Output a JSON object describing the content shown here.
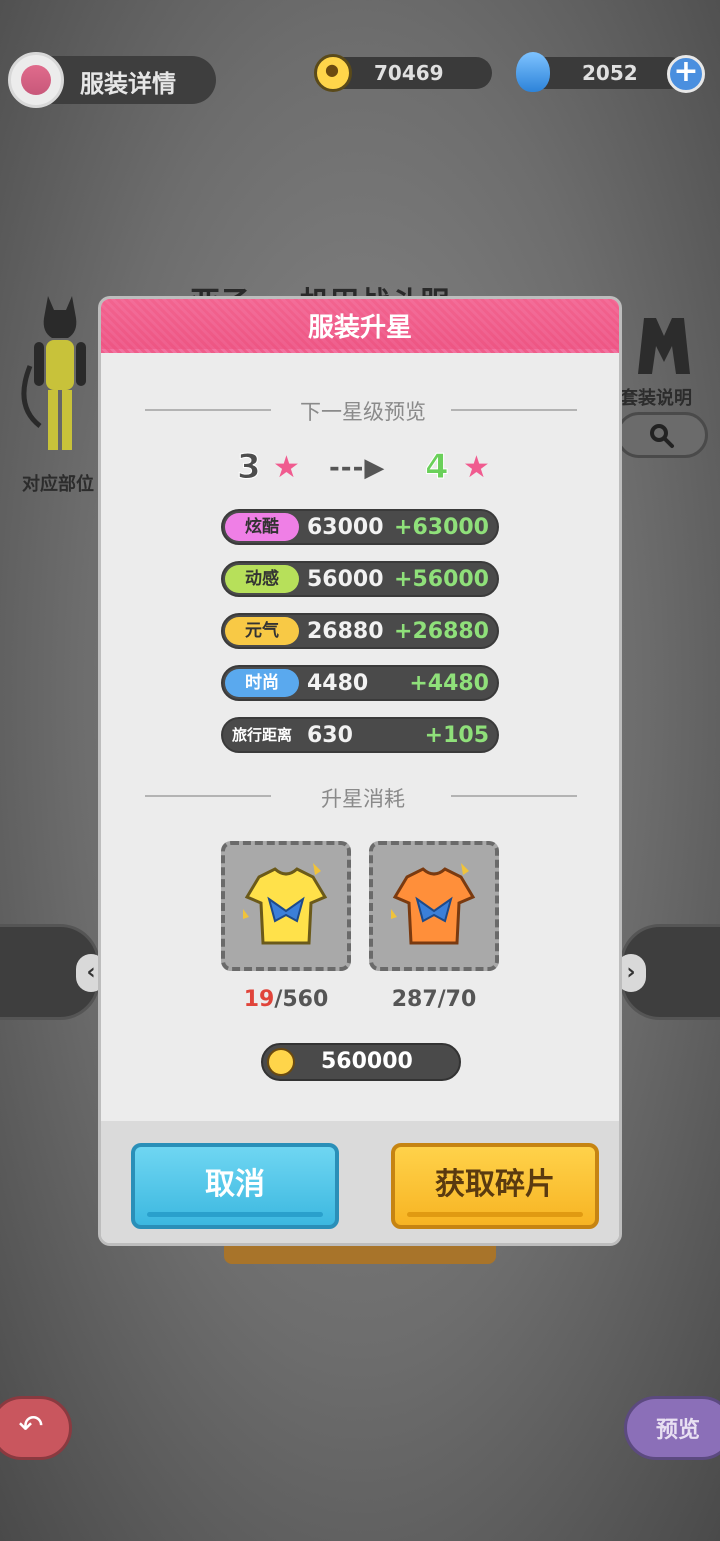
{
  "header": {
    "title": "服装详情",
    "coins": "70469",
    "gems": "2052"
  },
  "background": {
    "outfit_title": "亚子 cp机甲战斗服",
    "part_label": "对应部位",
    "set_label": "套装说明",
    "preview_label": "预览"
  },
  "modal": {
    "title": "服装升星",
    "preview_section": "下一星级预览",
    "star_from": "3",
    "star_to": "4",
    "arrow": "---▶",
    "stats": [
      {
        "label": "炫酷",
        "value": "63000",
        "add": "+63000",
        "color": "#ef7fe6"
      },
      {
        "label": "动感",
        "value": "56000",
        "add": "+56000",
        "color": "#b7e05a"
      },
      {
        "label": "元气",
        "value": "26880",
        "add": "+26880",
        "color": "#f8c945"
      },
      {
        "label": "时尚",
        "value": "4480",
        "add": "+4480",
        "color": "#5aa9ee"
      },
      {
        "label": "旅行距离",
        "value": "630",
        "add": "+105",
        "color": "#4a4a4a"
      }
    ],
    "cost_section": "升星消耗",
    "materials": [
      {
        "owned": "19",
        "need": "/560",
        "color": "#ffe14a"
      },
      {
        "owned": "287",
        "need": "/70",
        "color": "#ff8f3a"
      }
    ],
    "gold_cost": "560000",
    "cancel_label": "取消",
    "get_label": "获取碎片"
  }
}
